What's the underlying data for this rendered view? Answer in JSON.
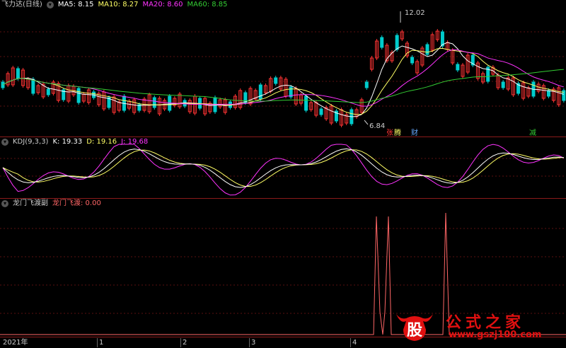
{
  "main_panel": {
    "title": "飞力达(日线)",
    "ma": [
      {
        "label": "MA5: 8.15",
        "color": "#ffffff"
      },
      {
        "label": "MA10: 8.27",
        "color": "#ffff66"
      },
      {
        "label": "MA20: 8.60",
        "color": "#ff33ff"
      },
      {
        "label": "MA60: 8.85",
        "color": "#33cc33"
      }
    ],
    "high_label": "12.02",
    "low_label": "6.84",
    "tags": [
      {
        "text": "张",
        "color": "#ff3333"
      },
      {
        "text": "腾",
        "color": "#ffff66"
      },
      {
        "text": "财",
        "color": "#66aaff"
      },
      {
        "text": "减",
        "color": "#33cc33"
      }
    ]
  },
  "kdj_panel": {
    "name": "KDJ(9,3,3)",
    "k": "K: 19.33",
    "d": "D: 19.16",
    "j": "J: 19.68",
    "k_color": "#ffffff",
    "d_color": "#ffff66",
    "j_color": "#ff33ff"
  },
  "dragon_panel": {
    "name": "龙门飞渡副",
    "value": "龙门飞渡: 0.00",
    "color": "#ff6666"
  },
  "xaxis": {
    "ticks": [
      "2021年",
      "1",
      "2",
      "3",
      "4"
    ]
  },
  "watermark": {
    "logo_char": "股",
    "title": "公式之家",
    "url": "www.gszj100.com"
  },
  "chart_data": {
    "type": "candlestick",
    "price_high": 12.02,
    "price_low": 6.84
  }
}
